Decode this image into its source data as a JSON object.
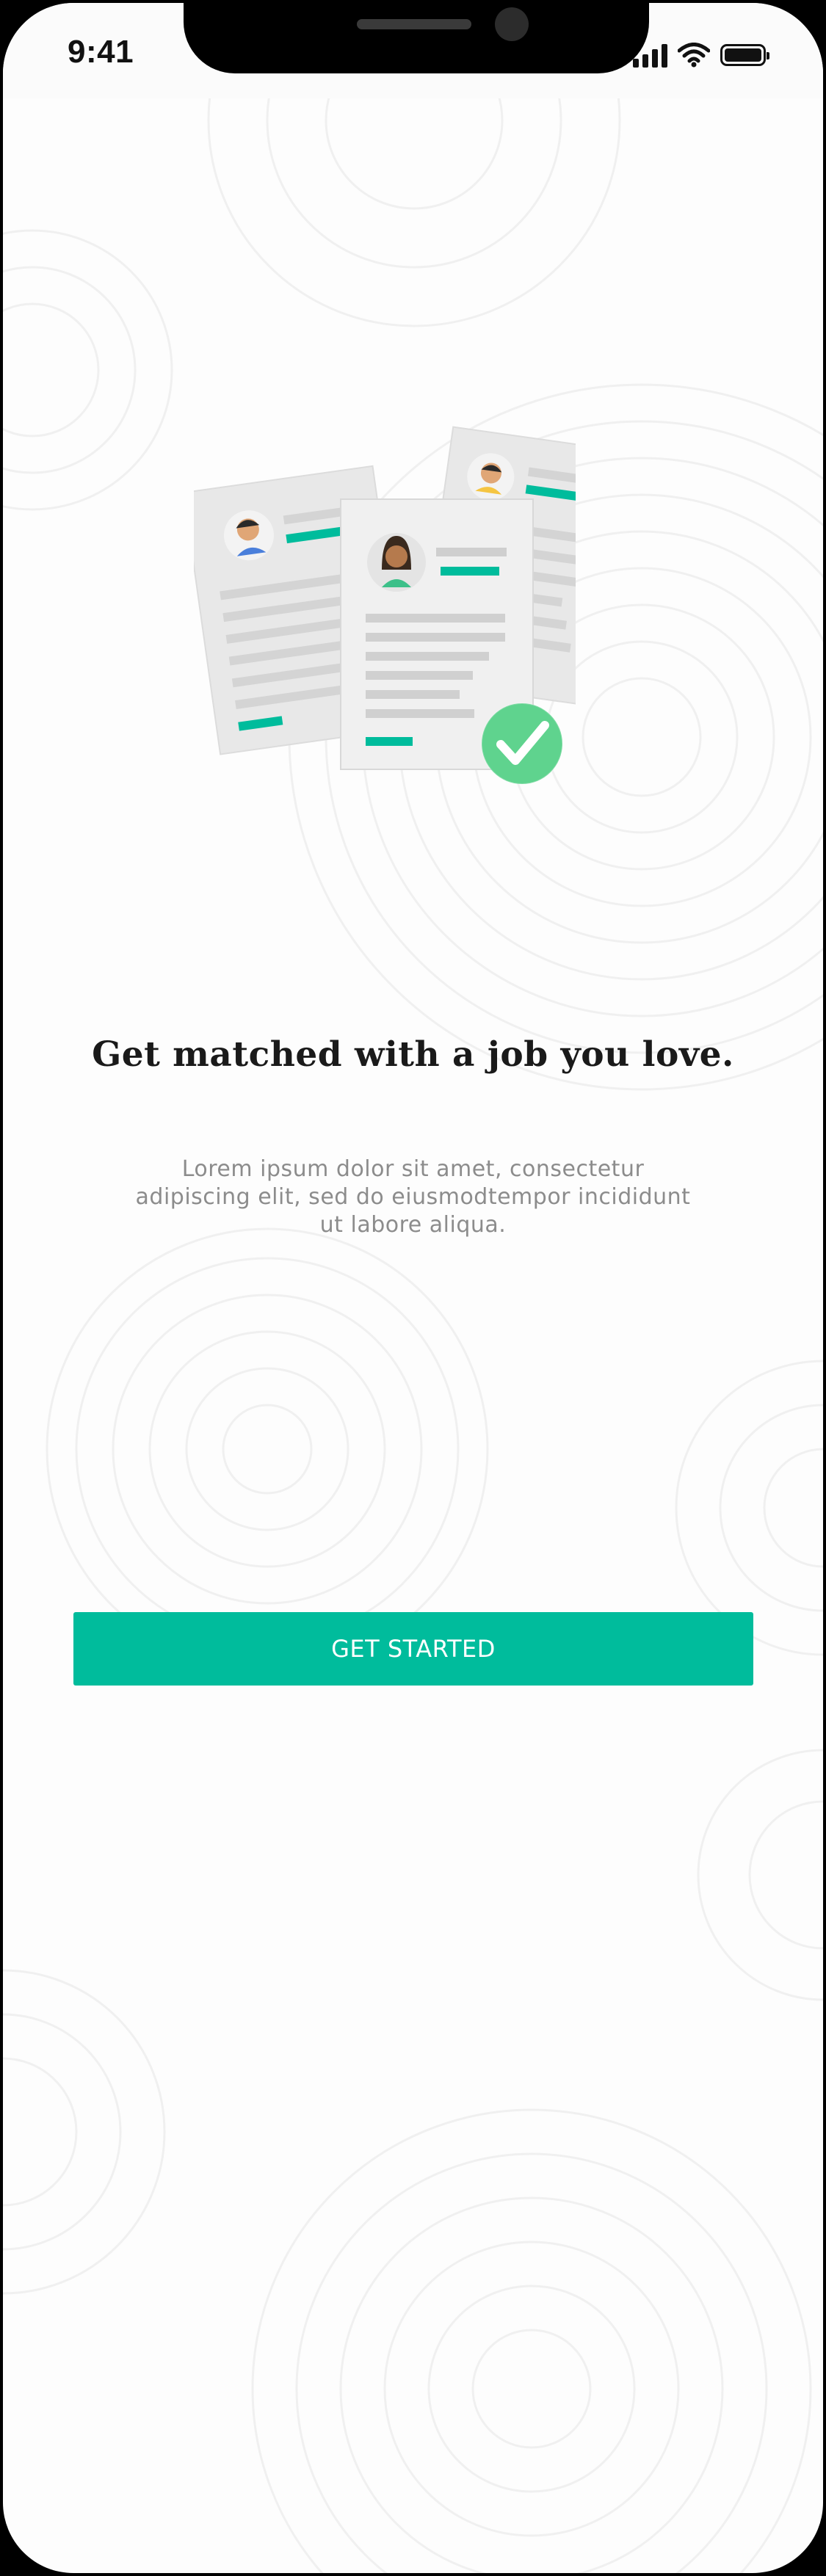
{
  "status_bar": {
    "time": "9:41",
    "icons": [
      "cellular-signal-icon",
      "wifi-icon",
      "battery-icon"
    ]
  },
  "onboarding": {
    "illustration": "resume-documents-checkmark-illustration",
    "headline": "Get matched with a job you love.",
    "description": "Lorem ipsum dolor sit amet, consectetur adipiscing elit, sed do eiusmodtempor incididunt ut labore aliqua.",
    "cta_label": "GET STARTED"
  },
  "colors": {
    "accent": "#00BC9C",
    "headline": "#1A1A1A",
    "body": "#8C8C8C",
    "background": "#FDFDFD"
  }
}
